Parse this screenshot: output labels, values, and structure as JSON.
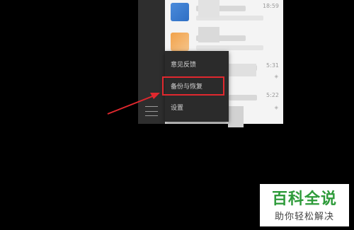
{
  "chat_list": {
    "items": [
      {
        "time": "18:59"
      },
      {
        "time": ""
      },
      {
        "time": "5:31"
      },
      {
        "time": "5:22"
      }
    ]
  },
  "popup_menu": {
    "items": [
      {
        "label": "意见反馈"
      },
      {
        "label": "备份与恢复"
      },
      {
        "label": "设置"
      }
    ]
  },
  "watermark": {
    "title": "百科全说",
    "subtitle": "助你轻松解决"
  },
  "colors": {
    "highlight": "#e0282e",
    "watermark_green": "#2e9b3a",
    "sidebar": "#2e2e2e",
    "popup": "#2b2b2b"
  },
  "icons": {
    "menu": "hamburger-menu-icon",
    "mute": "bell-mute-icon"
  }
}
